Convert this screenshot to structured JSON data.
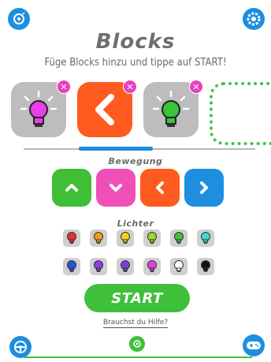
{
  "header": {
    "title": "Blocks",
    "subtitle": "Füge Blocks hinzu und tippe auf START!",
    "left_icon": "bluetooth-robot-icon",
    "right_icon": "gear-icon"
  },
  "sequence": {
    "blocks": [
      {
        "type": "light",
        "color": "#e83fe8"
      },
      {
        "type": "move",
        "direction": "left",
        "color": "#ff5a1f"
      },
      {
        "type": "light",
        "color": "#39c43b"
      }
    ],
    "remove_icon": "close-icon",
    "scroll_progress": 0.33
  },
  "movement": {
    "label": "Bewegung",
    "buttons": [
      {
        "name": "up",
        "color": "#3ebf35",
        "icon": "chevron-up-icon"
      },
      {
        "name": "down",
        "color": "#f04fb8",
        "icon": "chevron-down-icon"
      },
      {
        "name": "left",
        "color": "#ff5a1f",
        "icon": "chevron-left-icon"
      },
      {
        "name": "right",
        "color": "#1e8fe0",
        "icon": "chevron-right-icon"
      }
    ]
  },
  "lights": {
    "label": "Lichter",
    "colors": [
      "#e53030",
      "#f49a1a",
      "#f2d31a",
      "#a3d92a",
      "#3cc43c",
      "#3fd9d9",
      "#2753e0",
      "#8e3fe0",
      "#7b3fd9",
      "#e43fd9",
      "#ffffff",
      "#111111"
    ]
  },
  "actions": {
    "start_label": "START",
    "help_label": "Brauchst du Hilfe?"
  },
  "footer": {
    "left_icon": "steering-wheel-icon",
    "center_icon": "crosshair-icon",
    "right_icon": "gamepad-icon"
  },
  "theme": {
    "accent_blue": "#1e8fe0",
    "accent_green": "#3fbf3a",
    "remove_pink": "#e83fbf"
  }
}
